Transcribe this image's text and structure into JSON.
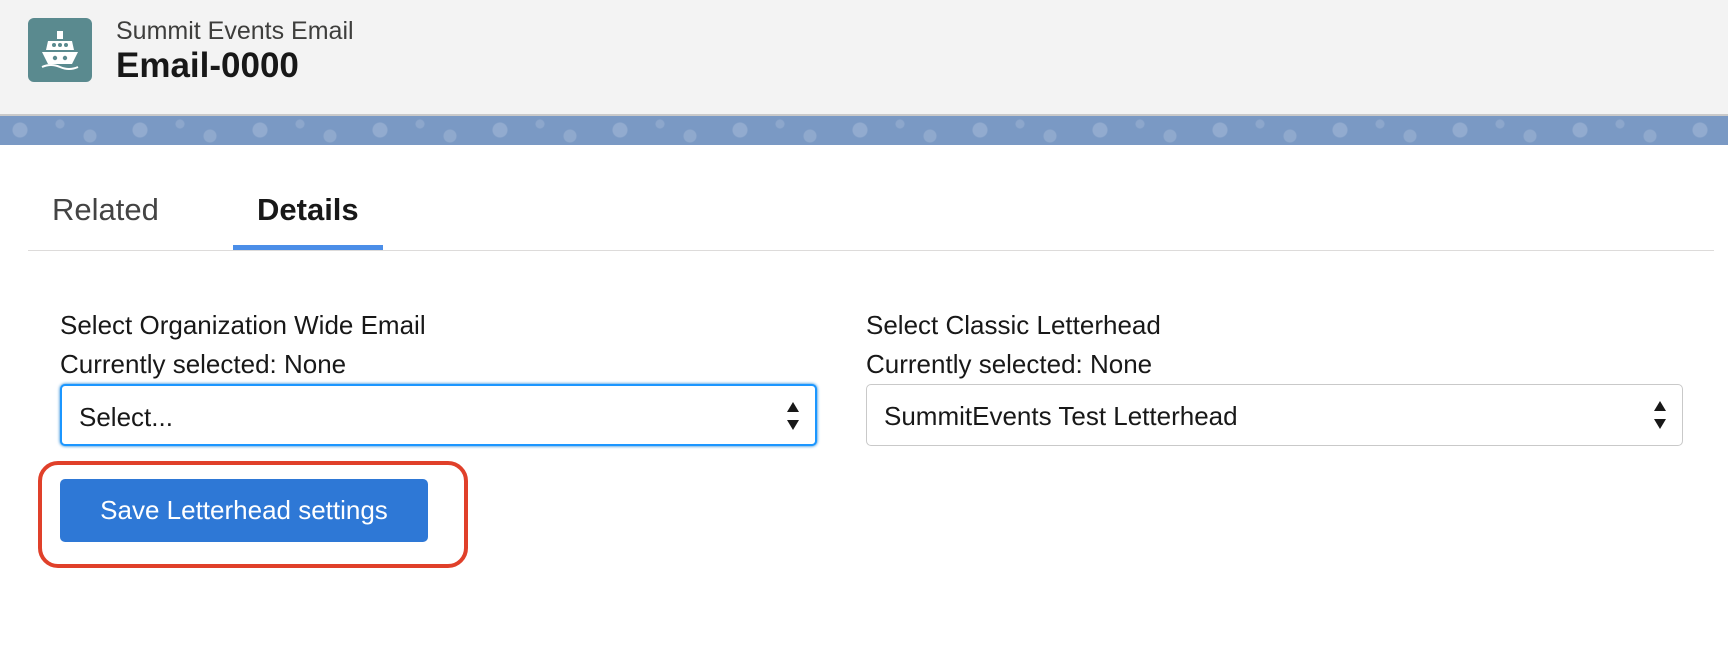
{
  "header": {
    "object_label": "Summit Events Email",
    "record_title": "Email-0000",
    "icon": "ship-icon",
    "icon_color": "#5a8a8f"
  },
  "tabs": [
    {
      "label": "Related",
      "active": false
    },
    {
      "label": "Details",
      "active": true
    }
  ],
  "org_email": {
    "label": "Select Organization Wide Email",
    "current": "Currently selected: None",
    "value": "Select..."
  },
  "letterhead": {
    "label": "Select Classic Letterhead",
    "current": "Currently selected: None",
    "value": "SummitEvents Test Letterhead"
  },
  "actions": {
    "save_label": "Save Letterhead settings"
  },
  "colors": {
    "button": "#2e78d6",
    "highlight": "#e0402a",
    "tab_active": "#4b8ee8",
    "banner": "#7a99c4"
  }
}
